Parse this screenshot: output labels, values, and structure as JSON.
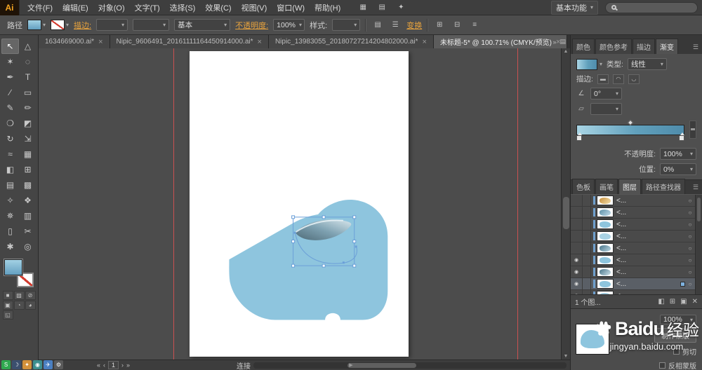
{
  "window": {
    "app_name": "Ai",
    "workspace": "基本功能"
  },
  "icons": {
    "caret": "▾",
    "close": "×",
    "overflow": "»",
    "tab_list": "▤",
    "menu": "☰",
    "eye": "◉",
    "target": "○",
    "scroll_up": "▲",
    "scroll_down": "▼",
    "scroll_left": "◀",
    "scroll_right": "▶",
    "nav_first": "«",
    "nav_prev": "‹",
    "nav_next": "›",
    "nav_last": "»",
    "angle": "∠",
    "aspect": "▱"
  },
  "menubar": {
    "items": [
      "文件(F)",
      "编辑(E)",
      "对象(O)",
      "文字(T)",
      "选择(S)",
      "效果(C)",
      "视图(V)",
      "窗口(W)",
      "帮助(H)"
    ],
    "extra_icons": [
      {
        "name": "bridge-icon",
        "glyph": "▦"
      },
      {
        "name": "arrange-documents-icon",
        "glyph": "▤"
      },
      {
        "name": "cs-live-icon",
        "glyph": "✦"
      }
    ]
  },
  "controlbar": {
    "context_label": "路径",
    "stroke_link": "描边:",
    "brush_preset": "基本",
    "opacity_link": "不透明度:",
    "opacity_value": "100%",
    "style_label": "样式:",
    "transform_link": "变换",
    "icon_buttons": [
      {
        "name": "document-setup-icon",
        "glyph": "▤"
      },
      {
        "name": "preferences-icon",
        "glyph": "☰"
      },
      {
        "name": "align-icon",
        "glyph": "⊞"
      },
      {
        "name": "distribute-icon",
        "glyph": "⊟"
      },
      {
        "name": "more-options-icon",
        "glyph": "≡"
      }
    ]
  },
  "tabbar": {
    "tabs": [
      {
        "label": "1634669000.ai*",
        "active": false
      },
      {
        "label": "Nipic_9606491_20161111164450914000.ai*",
        "active": false
      },
      {
        "label": "Nipic_13983055_20180727214204802000.ai*",
        "active": false
      },
      {
        "label": "未标题-5* @ 100.71% (CMYK/预览)",
        "active": true
      }
    ]
  },
  "tools": [
    {
      "name": "selection-tool",
      "glyph": "↖",
      "active": true
    },
    {
      "name": "direct-selection-tool",
      "glyph": "△"
    },
    {
      "name": "magic-wand-tool",
      "glyph": "✶"
    },
    {
      "name": "lasso-tool",
      "glyph": "◌"
    },
    {
      "name": "pen-tool",
      "glyph": "✒"
    },
    {
      "name": "type-tool",
      "glyph": "T"
    },
    {
      "name": "line-segment-tool",
      "glyph": "∕"
    },
    {
      "name": "rectangle-tool",
      "glyph": "▭"
    },
    {
      "name": "paintbrush-tool",
      "glyph": "✎"
    },
    {
      "name": "pencil-tool",
      "glyph": "✏"
    },
    {
      "name": "blob-brush-tool",
      "glyph": "❍"
    },
    {
      "name": "eraser-tool",
      "glyph": "◩"
    },
    {
      "name": "rotate-tool",
      "glyph": "↻"
    },
    {
      "name": "scale-tool",
      "glyph": "⇲"
    },
    {
      "name": "width-tool",
      "glyph": "≈"
    },
    {
      "name": "free-transform-tool",
      "glyph": "▦"
    },
    {
      "name": "shape-builder-tool",
      "glyph": "◧"
    },
    {
      "name": "perspective-grid-tool",
      "glyph": "⊞"
    },
    {
      "name": "mesh-tool",
      "glyph": "▤"
    },
    {
      "name": "gradient-tool",
      "glyph": "▩"
    },
    {
      "name": "eyedropper-tool",
      "glyph": "✧"
    },
    {
      "name": "blend-tool",
      "glyph": "❖"
    },
    {
      "name": "symbol-sprayer-tool",
      "glyph": "✵"
    },
    {
      "name": "column-graph-tool",
      "glyph": "▥"
    },
    {
      "name": "artboard-tool",
      "glyph": "▯"
    },
    {
      "name": "slice-tool",
      "glyph": "✂"
    },
    {
      "name": "hand-tool",
      "glyph": "✱"
    },
    {
      "name": "zoom-tool",
      "glyph": "◎"
    }
  ],
  "toolbox_extras": [
    {
      "name": "color-button",
      "glyph": "■"
    },
    {
      "name": "gradient-button",
      "glyph": "▨"
    },
    {
      "name": "none-button",
      "glyph": "⊘"
    },
    {
      "name": "draw-normal-button",
      "glyph": "▣"
    },
    {
      "name": "draw-behind-button",
      "glyph": "◔"
    },
    {
      "name": "draw-inside-button",
      "glyph": "◕"
    },
    {
      "name": "screen-mode-button",
      "glyph": "◱"
    }
  ],
  "statusbar": {
    "artboard_nav_page": "1",
    "hint": "连接"
  },
  "gradient_panel": {
    "tabs": [
      {
        "tab_id": "tab-color",
        "label": "颜色",
        "active": false
      },
      {
        "tab_id": "tab-color-guide",
        "label": "颜色参考",
        "active": false
      },
      {
        "tab_id": "tab-stroke",
        "label": "描边",
        "active": false
      },
      {
        "tab_id": "tab-gradient",
        "label": "渐变",
        "active": true
      }
    ],
    "type_label": "类型:",
    "type_value": "线性",
    "stroke_label": "描边:",
    "angle_value": "0°",
    "aspect_value": "",
    "opacity_label": "不透明度:",
    "opacity_value": "100%",
    "position_label": "位置:",
    "position_value": "0%",
    "bar_style": "background:linear-gradient(90deg,#a9d5e5,#61a0bc 55%,#4f8cab)"
  },
  "layers_panel": {
    "tabs": [
      {
        "tab_id": "tab-swatches",
        "label": "色板",
        "active": false
      },
      {
        "tab_id": "tab-brushes",
        "label": "画笔",
        "active": false
      },
      {
        "tab_id": "tab-layers",
        "label": "图层",
        "active": true
      },
      {
        "tab_id": "tab-pathfinder",
        "label": "路径查找器",
        "active": false
      }
    ],
    "rows": [
      {
        "label": "<...",
        "eye": false,
        "selected": false,
        "thumb_style": "background:linear-gradient(135deg,#c98f3a,#f2dfae)"
      },
      {
        "label": "<...",
        "eye": false,
        "selected": false,
        "thumb_style": "background:linear-gradient(135deg,#5d8fa6,#c2dcea)"
      },
      {
        "label": "<...",
        "eye": false,
        "selected": false,
        "thumb_style": "background:#8ec5de"
      },
      {
        "label": "<...",
        "eye": false,
        "selected": false,
        "thumb_style": "background:#a8d2e4"
      },
      {
        "label": "<...",
        "eye": false,
        "selected": false,
        "thumb_style": "background:linear-gradient(135deg,#49758a,#bcd8e4)"
      },
      {
        "label": "<...",
        "eye": true,
        "selected": false,
        "thumb_style": "background:#8ec5de"
      },
      {
        "label": "<...",
        "eye": true,
        "selected": false,
        "thumb_style": "background:linear-gradient(135deg,#49758a,#cfe2ea)"
      },
      {
        "label": "<...",
        "eye": true,
        "selected": true,
        "thumb_style": "background:#8ec5de"
      },
      {
        "label": "<...",
        "eye": true,
        "selected": false,
        "thumb_style": "background:#9fcbdf"
      }
    ],
    "footer_count": "1 个图...",
    "footer_icons": [
      {
        "name": "make-clip-mask-icon",
        "glyph": "◧"
      },
      {
        "name": "new-sublayer-icon",
        "glyph": "⊞"
      },
      {
        "name": "new-layer-icon",
        "glyph": "▣"
      },
      {
        "name": "delete-layer-icon",
        "glyph": "✕"
      }
    ]
  },
  "transparency_panel": {
    "opacity_value": "100%",
    "make_mask_label": "制作蒙版",
    "clip_label": "剪切",
    "invert_label": "反相蒙版"
  },
  "watermark": {
    "brand": "Baidu",
    "brand_suffix": "经验",
    "url": "jingyan.baidu.com"
  },
  "taskbar_icons": [
    {
      "glyph": "S",
      "style": "background:#2fa84f"
    },
    {
      "glyph": "☽",
      "style": "background:#3b4f6e"
    },
    {
      "glyph": "✦",
      "style": "background:#d2903a"
    },
    {
      "glyph": "◉",
      "style": "background:#3d8f8f"
    },
    {
      "glyph": "✈",
      "style": "background:#4a7fc1"
    },
    {
      "glyph": "⚙",
      "style": "background:#5a5a5a"
    }
  ],
  "artwork": {
    "shoe_color": "#8ec5de",
    "wedge_dark": "#4e6a77",
    "wedge_mid": "#7fa2b2",
    "wedge_light": "#d8e7ed",
    "selection_color": "#6b9fd8",
    "handle_fill": "#ffffff",
    "fill_swatch_style": "background:linear-gradient(180deg,#a2d1e4,#639fc0)",
    "thumb_blob_style": "background:#8ec5de"
  }
}
